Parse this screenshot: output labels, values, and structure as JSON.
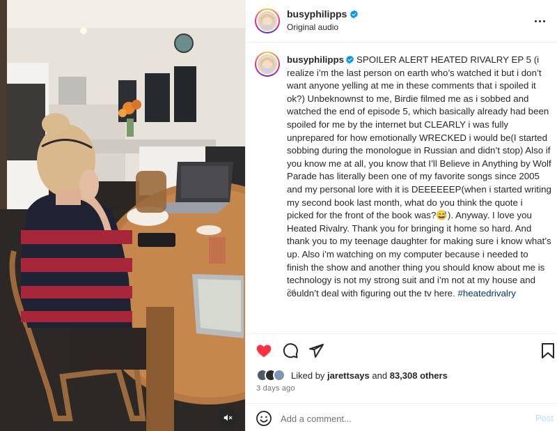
{
  "post": {
    "username": "busyphilipps",
    "audio_label": "Original audio",
    "caption_text": "SPOILER ALERT HEATED RIVALRY EP 5 (i realize i’m the last person on earth who’s watched it but i don’t want anyone yelling at me in these comments that i spoiled it ok?) Unbeknownst to me, Birdie filmed me as i sobbed and watched the end of episode 5, which basically already had been spoiled for me by the internet but CLEARLY i was fully unprepared for how emotionally WRECKED i would be(I started sobbing during the monologue in Russian and didn’t stop) Also if you know me at all, you know that I’ll Believe in Anything by Wolf Parade has literally been one of my favorite songs since 2005 and my personal lore with it is DEEEEEEP(when i started writing my second book last month, what do you think the quote i picked for the front of the book was?😅). Anyway. I love you Heated Rivalry. Thank you for bringing it home so hard. And thank you to my teenage daughter for making sure i know what’s up. Also i’m watching on my computer because i needed to finish the show and another thing you should know about me is technology is not my strong suit and i’m not at my house and couldn’t deal with figuring out the tv here.",
    "hashtag": "#heatedrivalry",
    "caption_age": "3d",
    "liked_prefix": "Liked by",
    "liked_by_user": "jarettsays",
    "liked_conjunction": "and",
    "liked_others": "83,308 others",
    "posted_date": "3 days ago"
  },
  "comment": {
    "placeholder": "Add a comment...",
    "post_label": "Post"
  },
  "icons": {
    "verified": "verified-badge-icon",
    "more": "more-options-icon",
    "like": "heart-filled-icon",
    "comment": "comment-bubble-icon",
    "share": "paper-plane-icon",
    "save": "bookmark-icon",
    "emoji": "emoji-smile-icon",
    "mute": "speaker-muted-icon"
  },
  "colors": {
    "like_red": "#ff3040",
    "verified_blue": "#0095f6",
    "hashtag": "#00376b",
    "muted_text": "#737373",
    "post_disabled": "#b3dbff"
  }
}
